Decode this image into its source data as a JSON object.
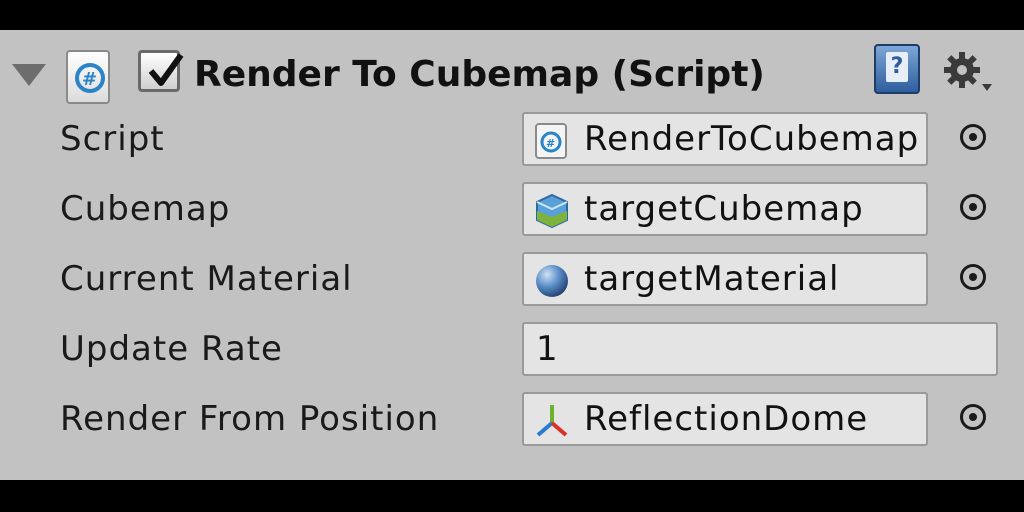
{
  "component": {
    "title": "Render To Cubemap (Script)",
    "enabled": true,
    "help_label": "?"
  },
  "properties": [
    {
      "label": "Script",
      "value": "RenderToCubemap",
      "icon": "cs-script-icon"
    },
    {
      "label": "Cubemap",
      "value": "targetCubemap",
      "icon": "cubemap-icon"
    },
    {
      "label": "Current Material",
      "value": "targetMaterial",
      "icon": "material-sphere-icon"
    },
    {
      "label": "Update Rate",
      "value": "1"
    },
    {
      "label": "Render From Position",
      "value": "ReflectionDome",
      "icon": "transform-axes-icon"
    }
  ]
}
